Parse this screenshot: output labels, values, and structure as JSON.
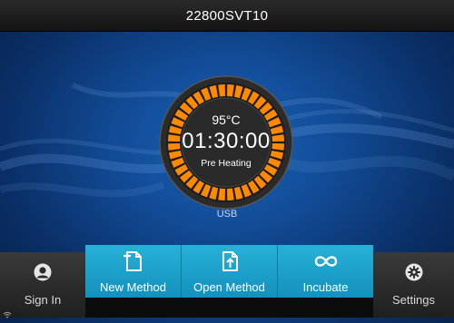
{
  "window": {
    "title": "22800SVT10"
  },
  "dial": {
    "temperature": "95°C",
    "time": "01:30:00",
    "status": "Pre Heating"
  },
  "storage": {
    "label": "USB"
  },
  "toolbar": {
    "sign_in": "Sign In",
    "new_method": "New Method",
    "open_method": "Open Method",
    "incubate": "Incubate",
    "settings": "Settings"
  },
  "colors": {
    "accent": "#1aa3cf",
    "ring": "#ff8a00",
    "background": "#124b96"
  },
  "icons": [
    "user-icon",
    "new-document-icon",
    "open-document-icon",
    "infinity-icon",
    "gear-icon",
    "wifi-icon"
  ]
}
